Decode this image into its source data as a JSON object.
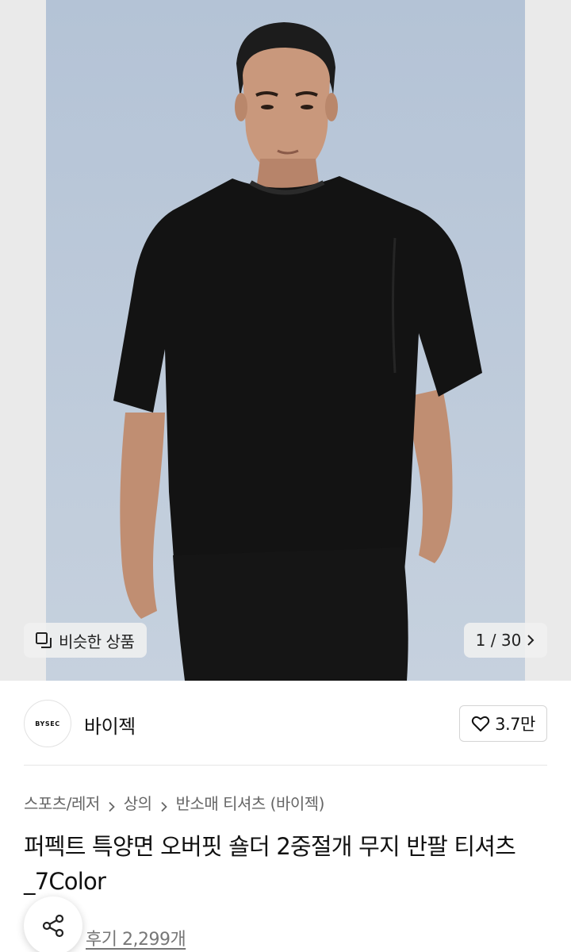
{
  "gallery": {
    "similar_label": "비슷한 상품",
    "counter_text": "1 / 30",
    "similar_icon": "similar-products-icon",
    "next_icon": "chevron-right-icon",
    "background_color": "#b9c7d8"
  },
  "brand": {
    "logo_text": "BYSEC",
    "name": "바이젝",
    "like_count": "3.7만",
    "like_icon": "heart-outline-icon"
  },
  "breadcrumb": {
    "items": [
      "스포츠/레저",
      "상의",
      "반소매 티셔츠 (바이젝)"
    ],
    "separator_icon": "chevron-right-icon"
  },
  "product": {
    "title": "퍼펙트 특양면 오버핏 숄더 2중절개 무지 반팔 티셔츠_7Color"
  },
  "actions": {
    "share_icon": "share-icon",
    "review_text": "후기 2,299개"
  }
}
